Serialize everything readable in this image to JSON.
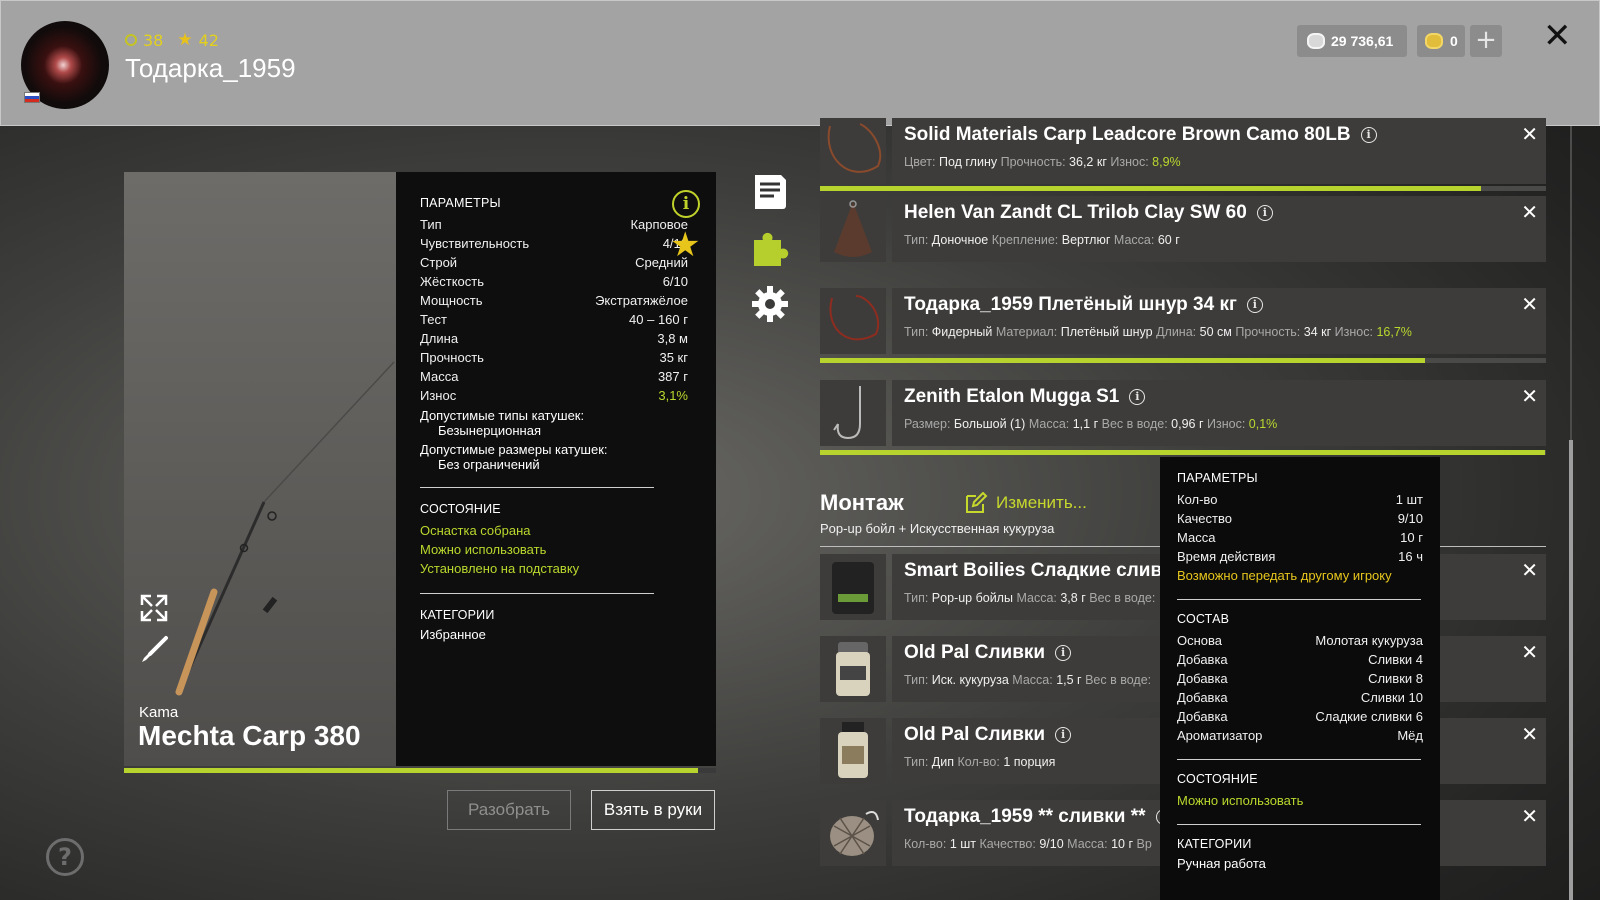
{
  "header": {
    "level": "38",
    "rank": "42",
    "username": "Тодарка_1959",
    "silver": "29 736,61",
    "gold": "0",
    "add_label": "+",
    "close_label": "✕"
  },
  "rod": {
    "brand": "Kama",
    "name": "Mechta Carp 380",
    "wear_fraction": 0.969,
    "disassemble_label": "Разобрать",
    "take_label": "Взять в руки",
    "params_title": "ПАРАМЕТРЫ",
    "params": [
      {
        "k": "Тип",
        "v": "Карповое"
      },
      {
        "k": "Чувствительность",
        "v": "4/10"
      },
      {
        "k": "Строй",
        "v": "Средний"
      },
      {
        "k": "Жёсткость",
        "v": "6/10"
      },
      {
        "k": "Мощность",
        "v": "Экстратяжёлое"
      },
      {
        "k": "Тест",
        "v": "40 – 160 г"
      },
      {
        "k": "Длина",
        "v": "3,8 м"
      },
      {
        "k": "Прочность",
        "v": "35 кг"
      },
      {
        "k": "Масса",
        "v": "387 г"
      },
      {
        "k": "Износ",
        "v": "3,1%"
      }
    ],
    "reel_types_label": "Допустимые типы катушек:",
    "reel_types_value": "Безынерционная",
    "reel_sizes_label": "Допустимые размеры катушек:",
    "reel_sizes_value": "Без ограничений",
    "state_title": "СОСТОЯНИЕ",
    "state": [
      "Оснастка собрана",
      "Можно использовать",
      "Установлено на подставку"
    ],
    "categories_title": "КАТЕГОРИИ",
    "category": "Избранное"
  },
  "items": [
    {
      "title": "Solid Materials Carp Leadcore Brown Camo 80LB",
      "meta": [
        [
          "Цвет:",
          "Под глину"
        ],
        [
          "Прочность:",
          "36,2 кг"
        ],
        [
          "Износ:",
          "8,9%"
        ]
      ],
      "wear_fraction": 0.911
    },
    {
      "title": "Helen Van Zandt CL Trilob Clay SW 60",
      "meta": [
        [
          "Тип:",
          "Доночное"
        ],
        [
          "Крепление:",
          "Вертлюг"
        ],
        [
          "Масса:",
          "60 г"
        ]
      ]
    },
    {
      "title": "Тодарка_1959 Плетёный шнур 34 кг",
      "meta": [
        [
          "Тип:",
          "Фидерный"
        ],
        [
          "Материал:",
          "Плетёный шнур"
        ],
        [
          "Длина:",
          "50 см"
        ],
        [
          "Прочность:",
          "34 кг"
        ],
        [
          "Износ:",
          "16,7%"
        ]
      ],
      "wear_fraction": 0.833
    },
    {
      "title": "Zenith Etalon Mugga S1",
      "meta": [
        [
          "Размер:",
          "Большой (1)"
        ],
        [
          "Масса:",
          "1,1 г"
        ],
        [
          "Вес в воде:",
          "0,96 г"
        ],
        [
          "Износ:",
          "0,1%"
        ]
      ],
      "wear_fraction": 0.999
    }
  ],
  "montage": {
    "title": "Монтаж",
    "edit_label": "Изменить...",
    "subtitle": "Pop-up бойл  +  Искусственная кукуруза"
  },
  "baits": [
    {
      "title": "Smart Boilies Сладкие сливки",
      "meta": [
        [
          "Тип:",
          "Pop-up бойлы"
        ],
        [
          "Масса:",
          "3,8 г"
        ],
        [
          "Вес в воде:",
          ""
        ]
      ]
    },
    {
      "title": "Old Pal Сливки",
      "meta": [
        [
          "Тип:",
          "Иск. кукуруза"
        ],
        [
          "Масса:",
          "1,5 г"
        ],
        [
          "Вес в воде:",
          ""
        ]
      ]
    },
    {
      "title": "Old Pal Сливки",
      "meta": [
        [
          "Тип:",
          "Дип"
        ],
        [
          "Кол-во:",
          "1 порция"
        ]
      ]
    },
    {
      "title": "Тодарка_1959 ** сливки **",
      "meta": [
        [
          "Кол-во:",
          "1 шт"
        ],
        [
          "Качество:",
          "9/10"
        ],
        [
          "Масса:",
          "10 г"
        ],
        [
          "Вр",
          ""
        ]
      ]
    }
  ],
  "tooltip": {
    "params_title": "ПАРАМЕТРЫ",
    "params": [
      {
        "k": "Кол-во",
        "v": "1 шт"
      },
      {
        "k": "Качество",
        "v": "9/10"
      },
      {
        "k": "Масса",
        "v": "10 г"
      },
      {
        "k": "Время действия",
        "v": "16 ч"
      }
    ],
    "transfer_note": "Возможно передать другому игроку",
    "composition_title": "СОСТАВ",
    "composition": [
      {
        "k": "Основа",
        "v": "Молотая кукуруза"
      },
      {
        "k": "Добавка",
        "v": "Сливки 4"
      },
      {
        "k": "Добавка",
        "v": "Сливки 8"
      },
      {
        "k": "Добавка",
        "v": "Сливки 10"
      },
      {
        "k": "Добавка",
        "v": "Сладкие сливки 6"
      },
      {
        "k": "Ароматизатор",
        "v": "Мёд"
      }
    ],
    "state_title": "СОСТОЯНИЕ",
    "state": "Можно использовать",
    "categories_title": "КАТЕГОРИИ",
    "category": "Ручная работа"
  },
  "colors": {
    "accent": "#b7d32e",
    "star": "#e8c51b",
    "note": "#e6c61d"
  }
}
